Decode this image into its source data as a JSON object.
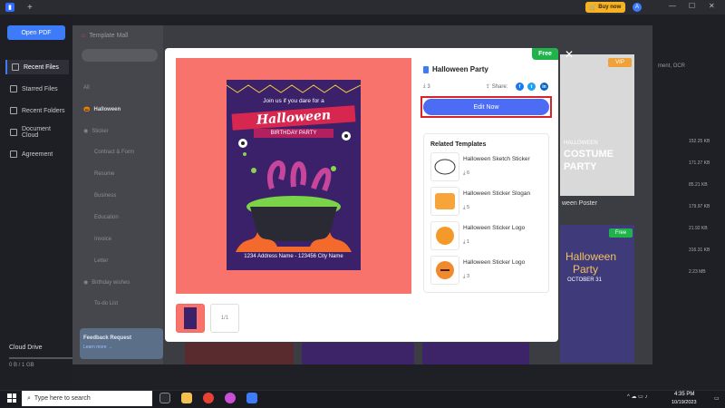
{
  "titlebar": {
    "buy_label": "Buy now",
    "avatar_initial": "A",
    "tab_new": "+",
    "min": "—",
    "max": "☐",
    "close": "✕"
  },
  "sidebar": {
    "open_pdf": "Open PDF",
    "items": [
      {
        "label": "Recent Files"
      },
      {
        "label": "Starred Files"
      },
      {
        "label": "Recent Folders"
      },
      {
        "label": "Document Cloud"
      },
      {
        "label": "Agreement"
      }
    ],
    "cloud_drive": "Cloud Drive",
    "cloud_size": "0 B / 1 GB"
  },
  "background_right": {
    "ocr_text": "ment, OCR",
    "sizes": [
      "152.25 KB",
      "171.27 KB",
      "85.21 KB",
      "179.97 KB",
      "21.92 KB",
      "316.31 KB",
      "2.23 MB"
    ]
  },
  "mall": {
    "title": "Template Mall",
    "categories": [
      "All",
      "Halloween",
      "Sticker",
      "Contract & Form",
      "Resume",
      "Business",
      "Education",
      "Invoice",
      "Letter",
      "Birthday wishes",
      "To-do List"
    ],
    "feedback_title": "Feedback Request",
    "feedback_link": "Learn more →"
  },
  "modal": {
    "badge": "Free",
    "close": "✕",
    "template_title": "Halloween Party",
    "download_count": "3",
    "share_label": "Share:",
    "edit_button": "Edit Now",
    "page_indicator": "1/1",
    "poster": {
      "top_text": "Join us if you dare for a",
      "headline": "Halloween",
      "subhead": "BIRTHDAY PARTY",
      "address": "1234 Address Name - 123456 City Name"
    },
    "related_title": "Related Templates",
    "related": [
      {
        "name": "Halloween Sketch Sticker",
        "count": "6"
      },
      {
        "name": "Halloween Sticker Slogan",
        "count": "5"
      },
      {
        "name": "Halloween Sticker Logo",
        "count": "1"
      },
      {
        "name": "Halloween Sticker Logo",
        "count": "3"
      }
    ]
  },
  "right_cards": {
    "vip": "VIP",
    "costume_l1": "HALLOWEEN",
    "costume_l2": "COSTUME",
    "costume_l3": "PARTY",
    "poster_label": "ween Poster",
    "free": "Free",
    "party_l1": "Halloween",
    "party_l2": "Party",
    "party_l3": "OCTOBER 31"
  },
  "taskbar": {
    "search_placeholder": "Type here to search",
    "time": "4:35 PM",
    "date": "10/19/2023"
  },
  "colors": {
    "accent": "#4d6cf5",
    "free_green": "#20b24b",
    "highlight_red": "#d8232a",
    "preview_bg": "#f8736b"
  }
}
